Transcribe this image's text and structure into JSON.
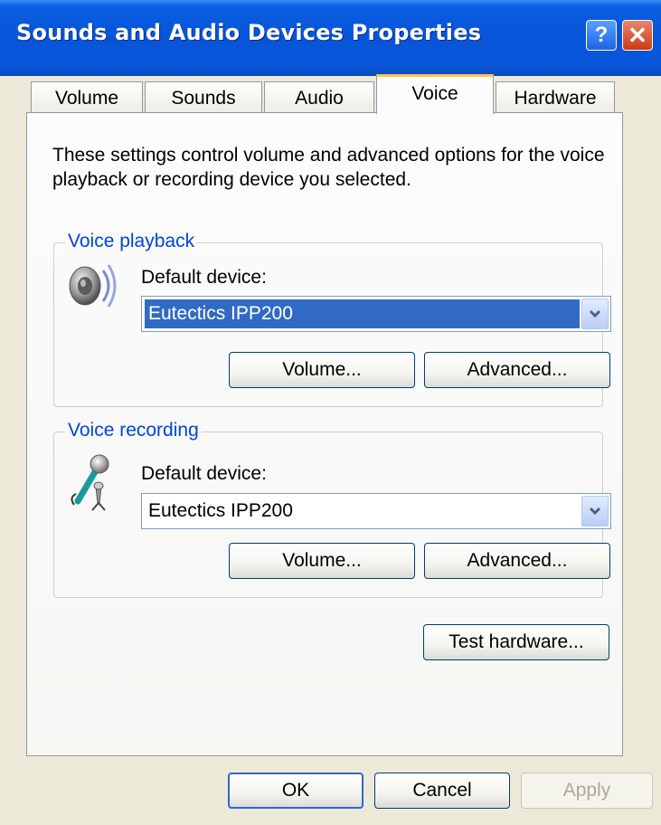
{
  "window": {
    "title": "Sounds and Audio Devices Properties",
    "help_label": "?",
    "close_label": "✕"
  },
  "tabs": [
    {
      "label": "Volume",
      "active": false
    },
    {
      "label": "Sounds",
      "active": false
    },
    {
      "label": "Audio",
      "active": false
    },
    {
      "label": "Voice",
      "active": true
    },
    {
      "label": "Hardware",
      "active": false
    }
  ],
  "voice": {
    "description": "These settings control volume and advanced options for the voice playback or recording device you selected.",
    "playback": {
      "group_label": "Voice playback",
      "icon": "speaker-icon",
      "device_label": "Default device:",
      "device_value": "Eutectics IPP200",
      "volume_label": "Volume...",
      "advanced_label": "Advanced..."
    },
    "recording": {
      "group_label": "Voice recording",
      "icon": "microphone-icon",
      "device_label": "Default device:",
      "device_value": "Eutectics IPP200",
      "volume_label": "Volume...",
      "advanced_label": "Advanced..."
    },
    "test_hardware_label": "Test hardware..."
  },
  "footer": {
    "ok_label": "OK",
    "cancel_label": "Cancel",
    "apply_label": "Apply"
  },
  "colors": {
    "titlebar": "#0754d8",
    "dialog_bg": "#ece9d8",
    "selection": "#316ac5",
    "group_label": "#0046d5",
    "active_tab_accent": "#ffc83c"
  }
}
